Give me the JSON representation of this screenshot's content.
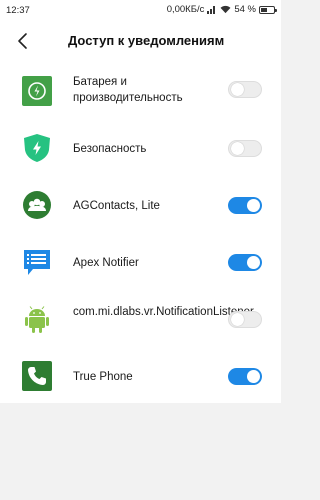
{
  "status_bar": {
    "time": "12:37",
    "network_speed": "0,00КБ/с",
    "battery_percent": "54 %",
    "icons": [
      "signal-icon",
      "wifi-icon",
      "battery-charging-icon"
    ],
    "battery_level": 0.54
  },
  "header": {
    "title": "Доступ к уведомлениям",
    "back_icon": "chevron-left-icon"
  },
  "apps": [
    {
      "label": "Батарея и производительность",
      "icon": "battery-performance-icon",
      "enabled": false
    },
    {
      "label": "Безопасность",
      "icon": "security-shield-icon",
      "enabled": false
    },
    {
      "label": "AGContacts, Lite",
      "icon": "agcontacts-icon",
      "enabled": true
    },
    {
      "label": "Apex Notifier",
      "icon": "apex-notifier-icon",
      "enabled": true
    },
    {
      "label": "com.mi.dlabs.vr.NotificationListener",
      "icon": "android-icon",
      "enabled": false
    },
    {
      "label": "True Phone",
      "icon": "phone-icon",
      "enabled": true
    }
  ],
  "colors": {
    "accent": "#1e88e5",
    "background": "#f2f2f2"
  }
}
